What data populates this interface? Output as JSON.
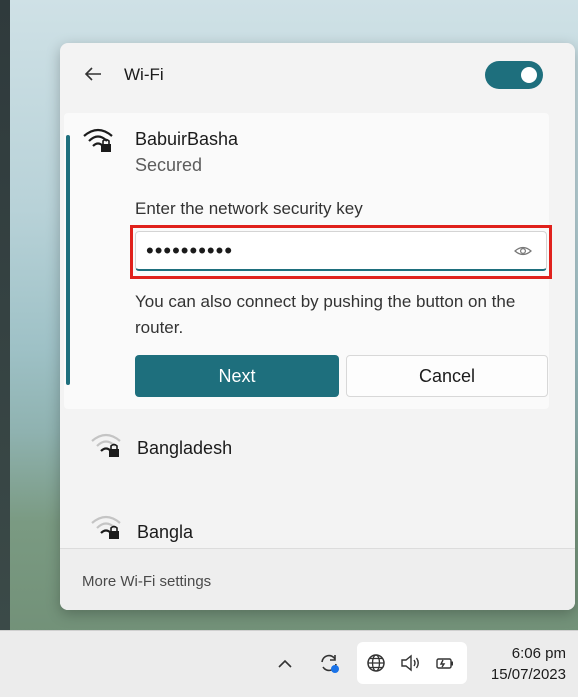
{
  "wifi_panel": {
    "title": "Wi-Fi",
    "toggle_on": true,
    "accent": "#1e6f7d",
    "connecting_network": {
      "name": "BabuirBasha",
      "status": "Secured",
      "icon": "wifi-secured-icon",
      "key_label": "Enter the network security key",
      "password_masked": "••••••••••",
      "reveal_icon": "eye-icon",
      "help_text": "You can also connect by pushing the button on the router.",
      "next_label": "Next",
      "cancel_label": "Cancel"
    },
    "networks": [
      {
        "name": "Bangladesh",
        "icon": "wifi-secured-icon"
      },
      {
        "name": "Bangla",
        "icon": "wifi-secured-icon"
      }
    ],
    "footer_link": "More Wi-Fi settings"
  },
  "taskbar": {
    "tray_icons": [
      "chevron-up-icon",
      "sync-icon",
      "globe-icon",
      "speaker-icon",
      "battery-icon"
    ],
    "time": "6:06 pm",
    "date": "15/07/2023"
  },
  "highlight_color": "#e0211c"
}
